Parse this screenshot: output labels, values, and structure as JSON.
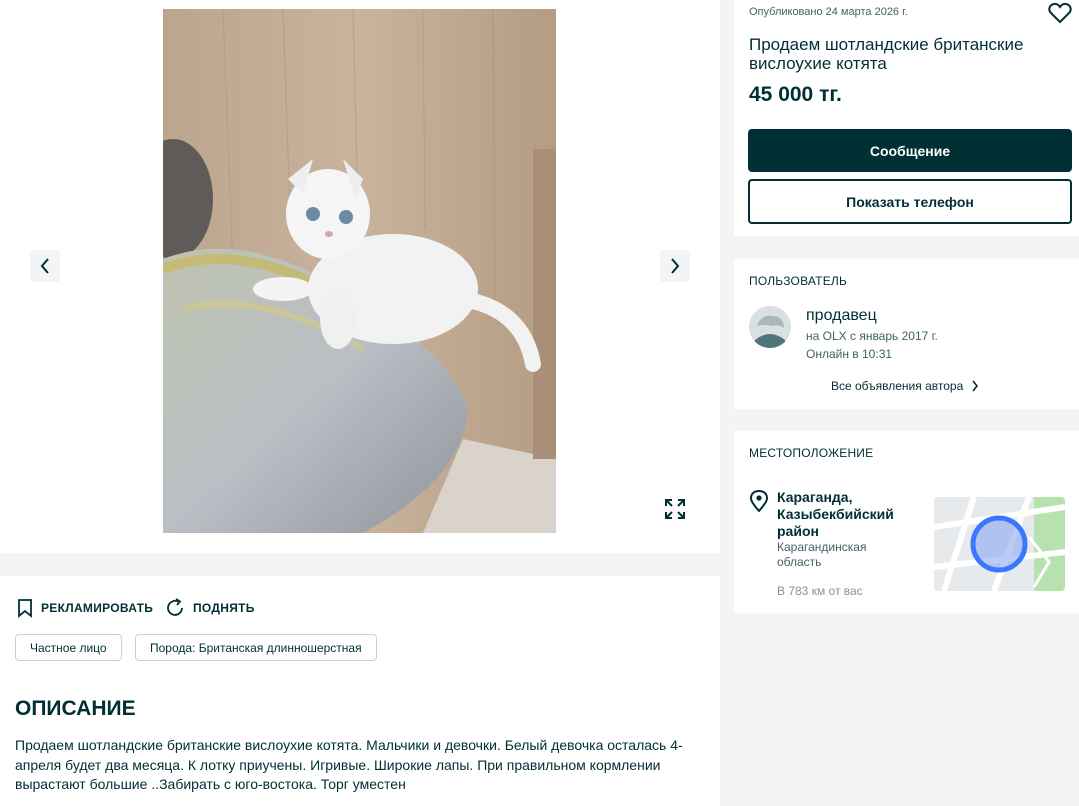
{
  "listing": {
    "published": "Опубликовано 24 марта 2026 г.",
    "title": "Продаем шотландские британские вислоухие котята",
    "price": "45 000 тг."
  },
  "buttons": {
    "message": "Сообщение",
    "show_phone": "Показать телефон"
  },
  "user": {
    "section_title": "ПОЛЬЗОВАТЕЛЬ",
    "name": "продавец",
    "since": "на OLX с январь 2017 г.",
    "online": "Онлайн в 10:31",
    "all_ads": "Все объявления автора"
  },
  "location": {
    "section_title": "МЕСТОПОЛОЖЕНИЕ",
    "city": "Караганда, Казыбекбийский район",
    "region": "Карагандинская область",
    "distance": "В 783 км от вас"
  },
  "actions": {
    "promote": "РЕКЛАМИРОВАТЬ",
    "raise": "ПОДНЯТЬ"
  },
  "tags": [
    "Частное лицо",
    "Порода: Британская длинношерстная"
  ],
  "description": {
    "title": "ОПИСАНИЕ",
    "text": "Продаем шотландские британские вислоухие котята. Мальчики и девочки. Белый девочка осталась 4-апреля будет два месяца. К лотку приучены. Игривые. Широкие лапы. При правильном кормлении вырастают большие ..Забирать с юго-востока. Торг уместен"
  },
  "colors": {
    "primary": "#002f34",
    "background": "#f2f4f5",
    "map_marker": "#3a77ff"
  },
  "icons": [
    "chevron-left-icon",
    "chevron-right-icon",
    "fullscreen-icon",
    "heart-icon",
    "map-pin-icon",
    "bookmark-icon",
    "refresh-icon",
    "chevron-right-small-icon"
  ]
}
